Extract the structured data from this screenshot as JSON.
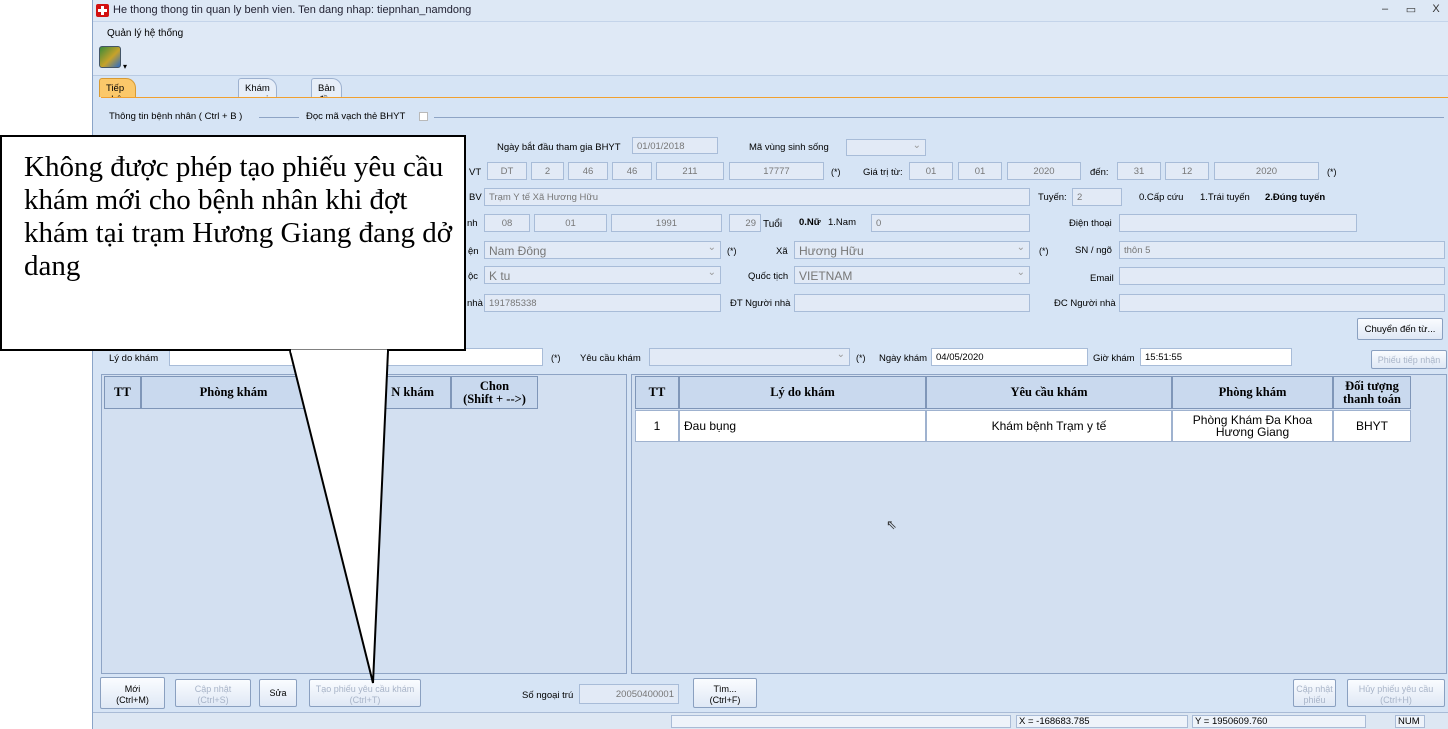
{
  "window": {
    "title": "He thong thong tin quan ly benh vien. Ten dang nhap: tiepnhan_namdong",
    "min": "–",
    "restore": "▭",
    "close": "X"
  },
  "menu": {
    "system": "Quản lý hệ thống"
  },
  "toolbar": {
    "icon": "people-settings-icon",
    "drop": "▾"
  },
  "tabs": [
    "Tiếp nhận bệnh nhân ngoại trú",
    "Khám ngoại trú",
    "Bản đồ"
  ],
  "section": {
    "title": "Thông tin bệnh nhân ( Ctrl + B )",
    "barcode_label": "Đọc mã vạch thẻ BHYT"
  },
  "bhyt": {
    "start_label": "Ngày bắt đầu tham gia BHYT",
    "start_value": "01/01/2018",
    "region_label": "Mã vùng sinh sống",
    "suffix_vt": "VT",
    "card": [
      "DT",
      "2",
      "46",
      "46",
      "211",
      "17777"
    ],
    "star": "(*)",
    "valid_from_label": "Giá trị từ:",
    "valid_from": [
      "01",
      "01",
      "2020"
    ],
    "valid_to_label": "đến:",
    "valid_to": [
      "31",
      "12",
      "2020"
    ],
    "suffix_bv": "BV",
    "facility": "Trạm Y tế Xã Hương Hữu",
    "tuyen_label": "Tuyến:",
    "tuyen_value": "2",
    "tuyen_options": [
      "0.Cấp cứu",
      "1.Trái tuyến",
      "2.Đúng tuyến"
    ]
  },
  "patient": {
    "suffix_dob": "nh",
    "dob": [
      "08",
      "01",
      "1991"
    ],
    "age": "29",
    "age_label": "Tuổi",
    "sex_female": "0.Nữ",
    "sex_male": "1.Nam",
    "sex_value": "0",
    "phone_label": "Điện thoại",
    "suffix_district": "ện",
    "district": "Nam Đông",
    "commune_label": "Xã",
    "commune": "Hương Hữu",
    "house_label": "SN / ngõ",
    "house": "thôn 5",
    "suffix_ethnic": "ộc",
    "ethnic": "K tu",
    "nationality_label": "Quốc tịch",
    "nationality": "VIETNAM",
    "email_label": "Email",
    "suffix_family": "nhà",
    "family_phone": "191785338",
    "family_phone_label": "ĐT Người nhà",
    "family_addr_label": "ĐC Người nhà"
  },
  "transfer_button": "Chuyển đến từ...",
  "exam": {
    "reason_label": "Lý do khám",
    "req_label": "Yêu cầu khám",
    "date_label": "Ngày khám",
    "date_value": "04/05/2020",
    "time_label": "Giờ khám",
    "time_value": "15:51:55",
    "slip_button": "Phiếu tiếp nhận"
  },
  "left_grid": {
    "headers": [
      "TT",
      "Phòng khám",
      "N khám",
      "Chon\n(Shift + -->)"
    ]
  },
  "right_grid": {
    "headers": [
      "TT",
      "Lý do khám",
      "Yêu cầu khám",
      "Phòng khám",
      "Đối tượng thanh toán"
    ],
    "rows": [
      [
        "1",
        "Đau bụng",
        "Khám bệnh Trạm y tế",
        "Phòng Khám Đa Khoa Hương Giang",
        "BHYT"
      ]
    ]
  },
  "buttons": {
    "new": "Mới\n(Ctrl+M)",
    "update": "Cập nhật\n(Ctrl+S)",
    "edit": "Sửa",
    "create_slip": "Tạo phiếu yêu cầu khám\n(Ctrl+T)",
    "outpatient_no_label": "Số ngoại trú",
    "outpatient_no": "20050400001",
    "search": "Tìm...\n(Ctrl+F)",
    "update_slip": "Cập nhật\nphiếu",
    "cancel_slip": "Hủy phiếu yêu cầu\n(Ctrl+H)"
  },
  "status": {
    "x": "X = -168683.785",
    "y": "Y = 1950609.760",
    "num": "NUM"
  },
  "callout": "Không được phép tạo phiếu yêu cầu khám mới cho bệnh nhân khi đợt khám tại trạm Hương Giang đang dở dang"
}
